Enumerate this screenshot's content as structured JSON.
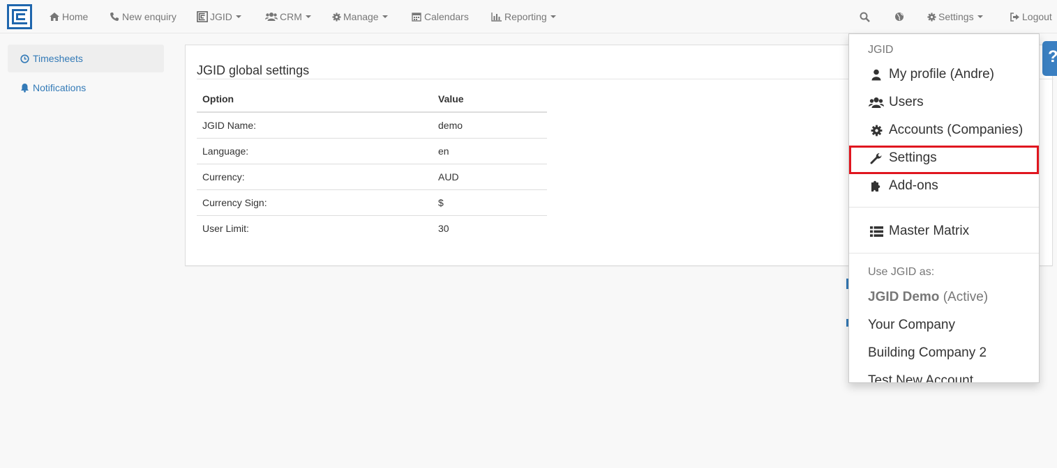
{
  "navbar": {
    "home": "Home",
    "new_enquiry": "New enquiry",
    "jgid": "JGID",
    "crm": "CRM",
    "manage": "Manage",
    "calendars": "Calendars",
    "reporting": "Reporting",
    "settings": "Settings",
    "logout": "Logout"
  },
  "sidebar": {
    "items": [
      {
        "label": "Timesheets",
        "icon": "clock-icon"
      },
      {
        "label": "Notifications",
        "icon": "bell-icon"
      }
    ]
  },
  "panel": {
    "title": "JGID global settings",
    "columns": [
      "Option",
      "Value"
    ],
    "rows": [
      {
        "option": "JGID Name:",
        "value": "demo"
      },
      {
        "option": "Language:",
        "value": "en"
      },
      {
        "option": "Currency:",
        "value": "AUD"
      },
      {
        "option": "Currency Sign:",
        "value": "$"
      },
      {
        "option": "User Limit:",
        "value": "30"
      }
    ]
  },
  "help": {
    "label": "?"
  },
  "dropdown": {
    "header1": "JGID",
    "items": [
      {
        "label": "My profile (Andre)",
        "icon": "user-icon"
      },
      {
        "label": "Users",
        "icon": "users-icon"
      },
      {
        "label": "Accounts (Companies)",
        "icon": "gear-icon"
      },
      {
        "label": "Settings",
        "icon": "wrench-icon"
      },
      {
        "label": "Add-ons",
        "icon": "puzzle-icon"
      }
    ],
    "master_matrix": "Master Matrix",
    "header2": "Use JGID as:",
    "active_account": "JGID Demo",
    "active_suffix": "(Active)",
    "accounts": [
      "Your Company",
      "Building Company 2",
      "Test New Account"
    ]
  },
  "colors": {
    "link": "#337ab7",
    "highlight": "#e0161f",
    "brand": "#1f66ad"
  }
}
